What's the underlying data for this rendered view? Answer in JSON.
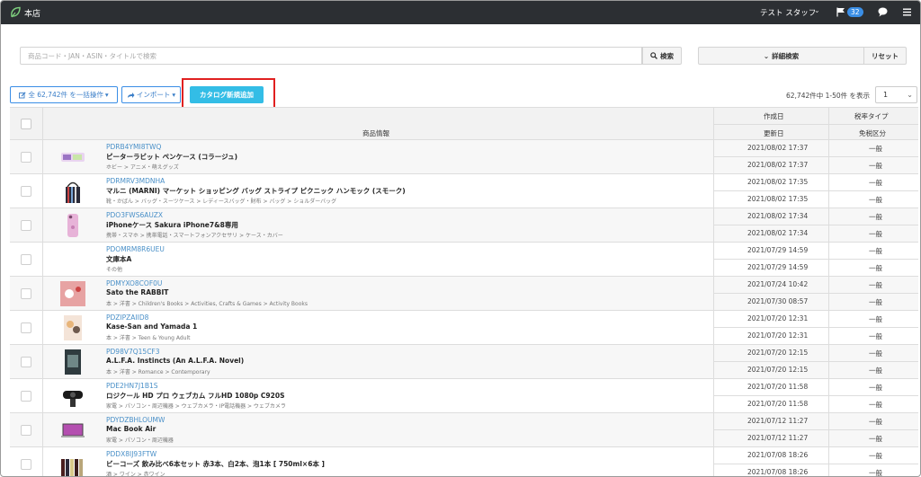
{
  "header": {
    "store_name": "本店",
    "user_name": "テスト スタッフ",
    "notification_count": "32"
  },
  "search": {
    "placeholder": "商品コード・JAN・ASIN・タイトルで検索",
    "search_label": "検索",
    "advanced_label": "詳細検索",
    "reset_label": "リセット"
  },
  "actions": {
    "bulk_label": "全 62,742件 を一括操作",
    "import_label": "インポート",
    "add_catalog_label": "カタログ新規追加"
  },
  "pagination": {
    "info": "62,742件中 1-50件 を表示",
    "current_page": "1"
  },
  "table": {
    "headers": {
      "product_info": "商品情報",
      "created": "作成日",
      "updated": "更新日",
      "tax_type": "税率タイプ",
      "tax_category": "免税区分"
    },
    "rows": [
      {
        "code": "PDRB4YMI8TWQ",
        "title": "ピーターラビット ペンケース (コラージュ)",
        "category": "ホビー > アニメ・萌えグッズ",
        "created": "2021/08/02 17:37",
        "updated": "2021/08/02 17:37",
        "tax_type": "一般",
        "tax_category": "一般",
        "thumb": "pencase"
      },
      {
        "code": "PDRMRV3MDNHA",
        "title": "マルニ (MARNI) マーケット ショッピング バッグ ストライプ ピクニック ハンモック (スモーク)",
        "category": "靴・かばん > バッグ・スーツケース > レディースバッグ・財布 > バッグ > ショルダーバッグ",
        "created": "2021/08/02 17:35",
        "updated": "2021/08/02 17:35",
        "tax_type": "一般",
        "tax_category": "一般",
        "thumb": "bag"
      },
      {
        "code": "PDO3FWS6AUZX",
        "title": "iPhoneケース Sakura iPhone7&8専用",
        "category": "携帯・スマホ > 携帯電話・スマートフォンアクセサリ > ケース・カバー",
        "created": "2021/08/02 17:34",
        "updated": "2021/08/02 17:34",
        "tax_type": "一般",
        "tax_category": "一般",
        "thumb": "phonecase"
      },
      {
        "code": "PDOMRM8R6UEU",
        "title": "文庫本A",
        "category": "その他",
        "created": "2021/07/29 14:59",
        "updated": "2021/07/29 14:59",
        "tax_type": "一般",
        "tax_category": "一般",
        "thumb": "none"
      },
      {
        "code": "PDMYXO8COF0U",
        "title": "Sato the RABBIT",
        "category": "本 > 洋書 > Children's Books > Activities, Crafts & Games > Activity Books",
        "created": "2021/07/24 10:42",
        "updated": "2021/07/30 08:57",
        "tax_type": "一般",
        "tax_category": "一般",
        "thumb": "book-red"
      },
      {
        "code": "PDZIPZAIID8",
        "title": "Kase-San and Yamada 1",
        "category": "本 > 洋書 > Teen & Young Adult",
        "created": "2021/07/20 12:31",
        "updated": "2021/07/20 12:31",
        "tax_type": "一般",
        "tax_category": "一般",
        "thumb": "book-manga"
      },
      {
        "code": "PD98V7Q15CF3",
        "title": "A.L.F.A. Instincts (An A.L.F.A. Novel)",
        "category": "本 > 洋書 > Romance > Contemporary",
        "created": "2021/07/20 12:15",
        "updated": "2021/07/20 12:15",
        "tax_type": "一般",
        "tax_category": "一般",
        "thumb": "book-dark"
      },
      {
        "code": "PDE2HN7J1B1S",
        "title": "ロジクール HD プロ ウェブカム フルHD 1080p C920S",
        "category": "家電 > パソコン・周辺機器 > ウェブカメラ・IP電話機器 > ウェブカメラ",
        "created": "2021/07/20 11:58",
        "updated": "2021/07/20 11:58",
        "tax_type": "一般",
        "tax_category": "一般",
        "thumb": "webcam"
      },
      {
        "code": "PDYDZBHLOUMW",
        "title": "Mac Book Air",
        "category": "家電 > パソコン・周辺機器",
        "created": "2021/07/12 11:27",
        "updated": "2021/07/12 11:27",
        "tax_type": "一般",
        "tax_category": "一般",
        "thumb": "laptop"
      },
      {
        "code": "PDDX8IJ93FTW",
        "title": "ビーコーズ 飲み比べ6本セット 赤3本、白2本、泡1本 [ 750ml×6本 ]",
        "category": "酒 > ワイン > 赤ワイン",
        "created": "2021/07/08 18:26",
        "updated": "2021/07/08 18:26",
        "tax_type": "一般",
        "tax_category": "一般",
        "thumb": "wine"
      }
    ]
  },
  "colors": {
    "topbar": "#2c2f33",
    "accent": "#33bde6",
    "link": "#4a90c8",
    "highlight": "#e02020"
  }
}
